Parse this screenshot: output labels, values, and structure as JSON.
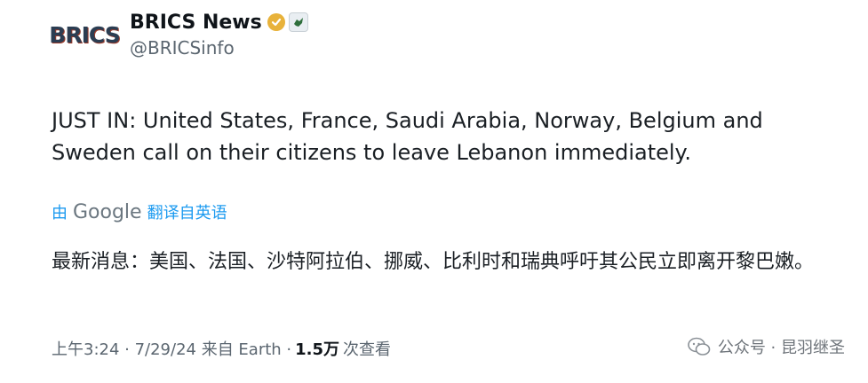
{
  "account": {
    "avatar_text": "BRICS",
    "display_name": "BRICS News",
    "handle": "@BRICSinfo"
  },
  "tweet": {
    "text": "JUST IN: United States, France, Saudi Arabia, Norway, Belgium and Sweden call on their citizens to leave Lebanon immediately."
  },
  "translation": {
    "prefix": "由",
    "provider": "Google",
    "action": "翻译自英语",
    "text": "最新消息：美国、法国、沙特阿拉伯、挪威、比利时和瑞典呼吁其公民立即离开黎巴嫩。"
  },
  "meta": {
    "timestamp": "上午3:24 · 7/29/24 来自 Earth ·",
    "views": "1.5万",
    "views_label": "次查看"
  },
  "watermark": {
    "text": "公众号 · 昆羽继圣"
  },
  "colors": {
    "link": "#1d9bf0",
    "verified": "#e8b23a",
    "muted": "#5b6670"
  }
}
